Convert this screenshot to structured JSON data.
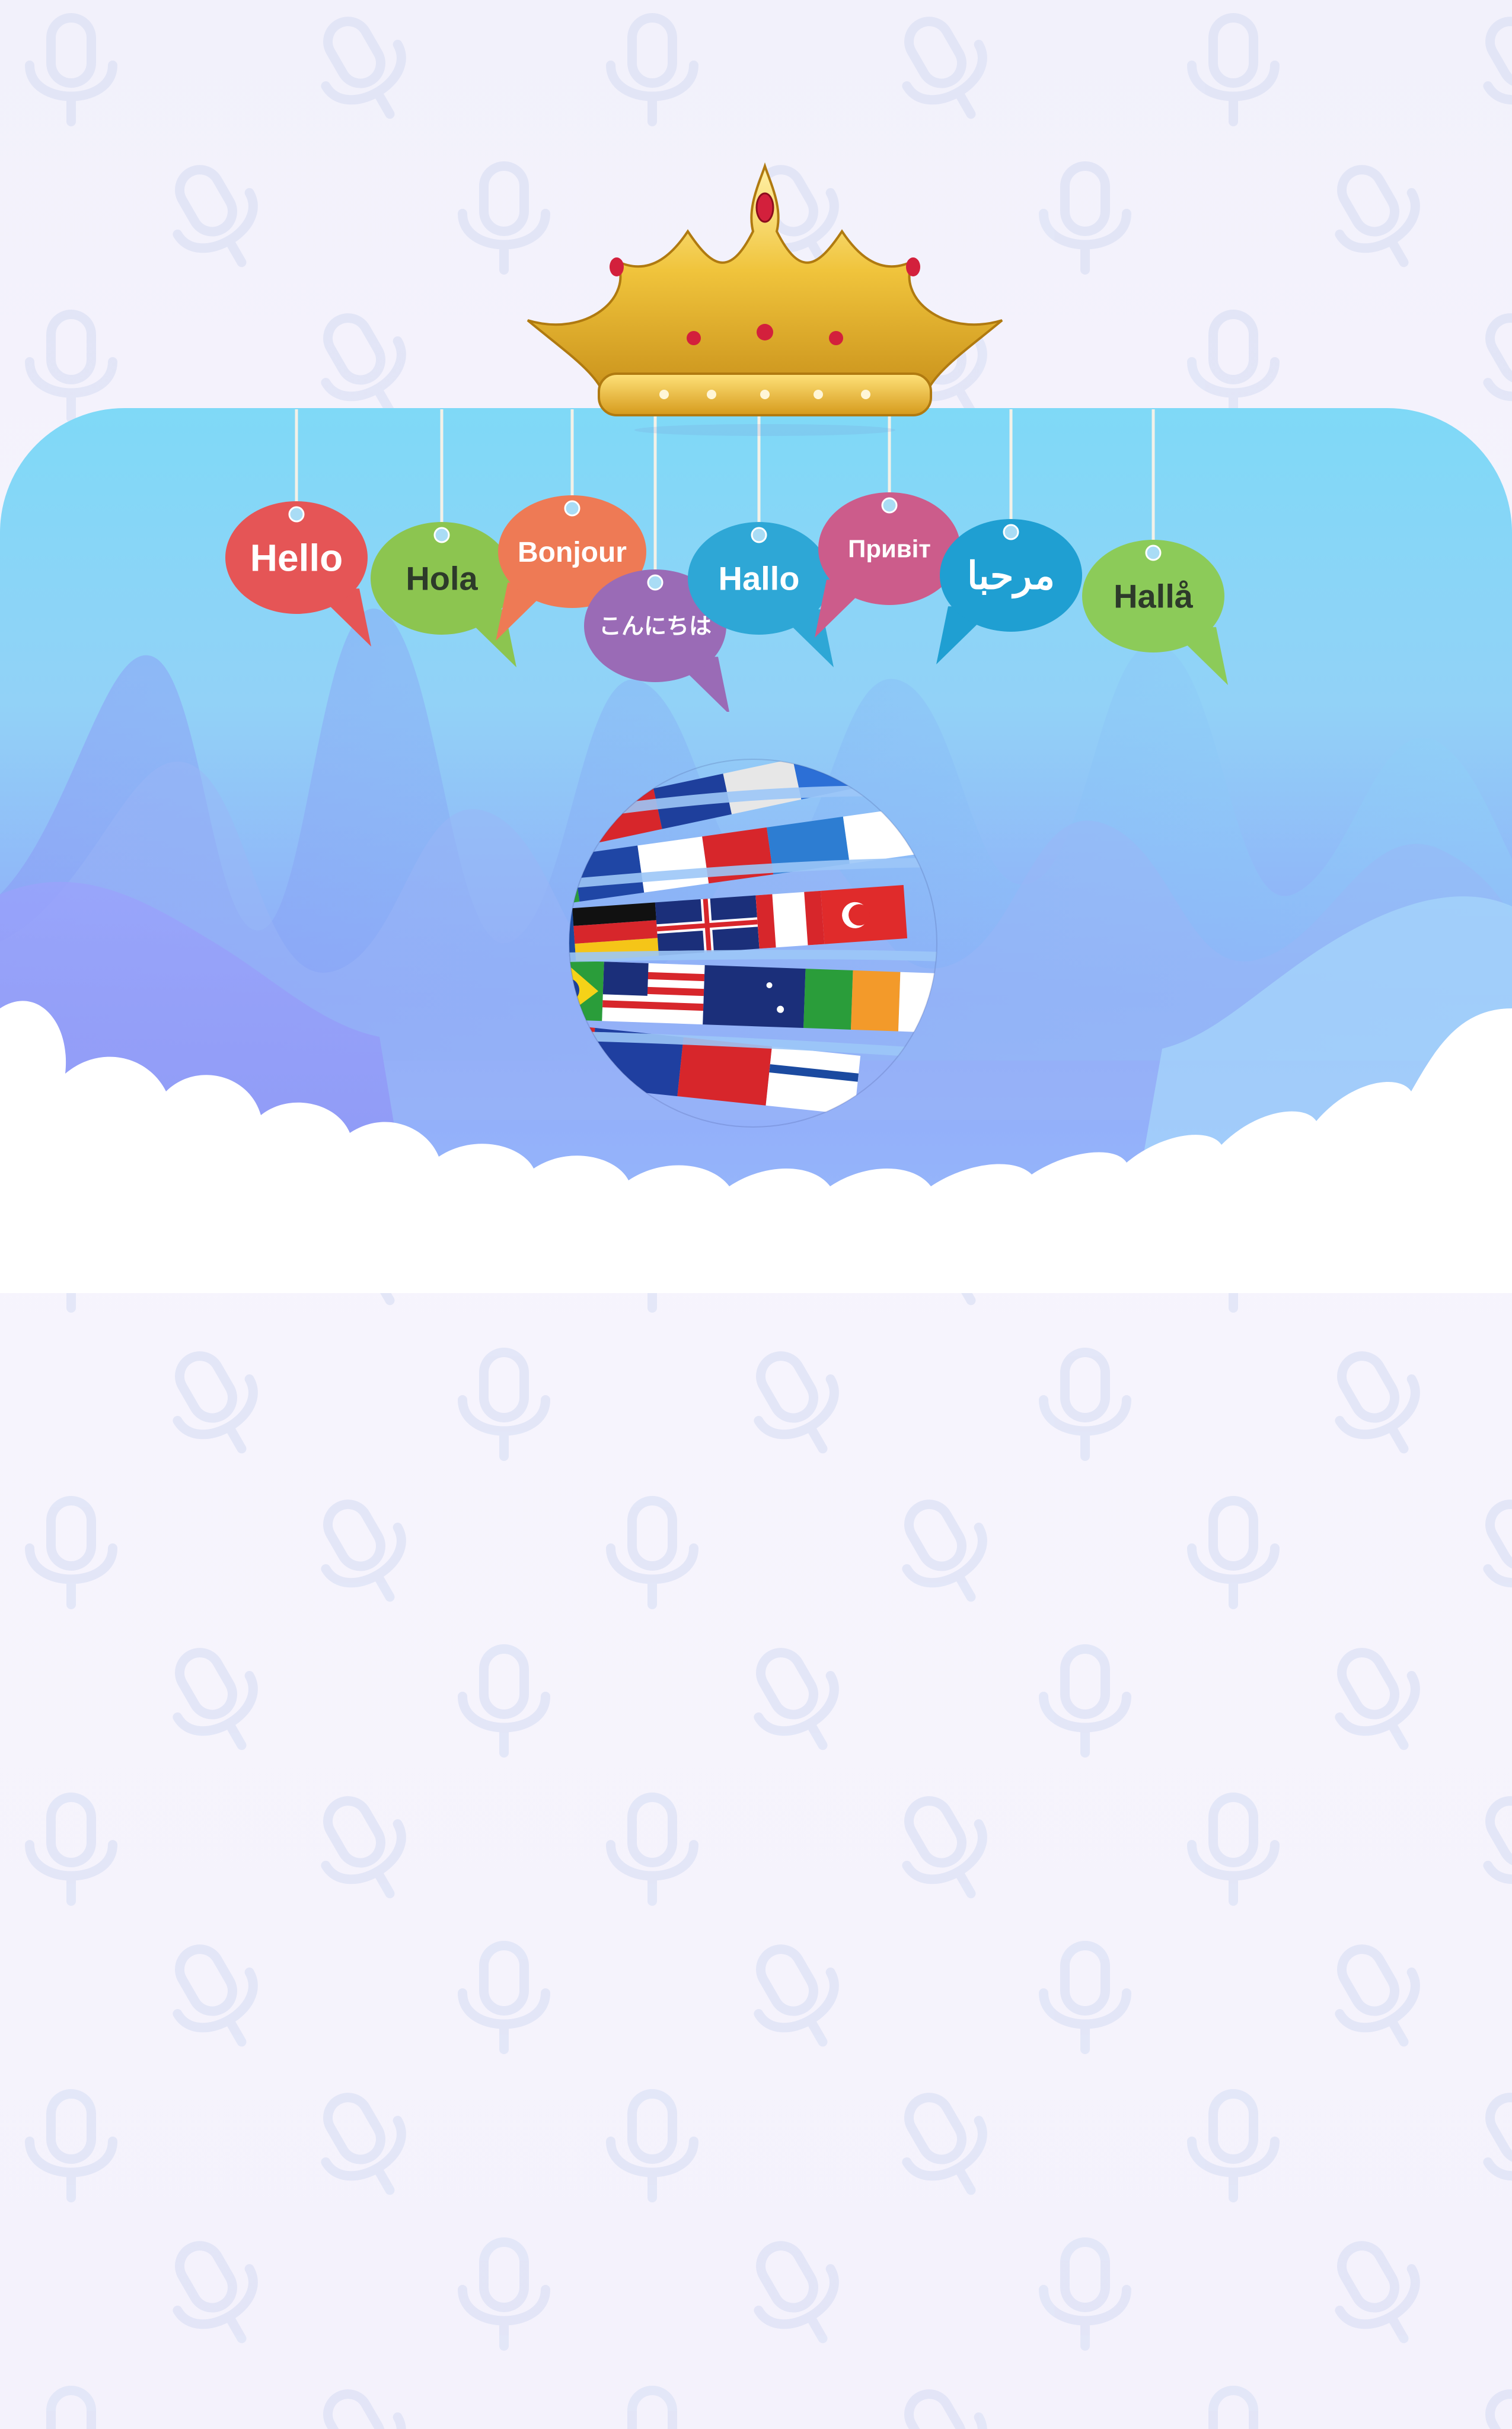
{
  "colors": {
    "page_bg": "#f4f2fc",
    "pattern_icon": "#dfe3f6",
    "hero_top": "#7fd9f7",
    "hero_bottom": "#8fa8f8",
    "cloud": "#ffffff",
    "crown_gold": "#e8b92d",
    "jewel_red": "#d3203c"
  },
  "greetings": [
    {
      "text": "Hello",
      "color": "#e55556"
    },
    {
      "text": "Hola",
      "color": "#8cc550"
    },
    {
      "text": "Bonjour",
      "color": "#ee7a55"
    },
    {
      "text": "こんにちは",
      "color": "#9a6bb6"
    },
    {
      "text": "Hallo",
      "color": "#2ea7d6"
    },
    {
      "text": "Привіт",
      "color": "#cc5c8b"
    },
    {
      "text": "مرحبا",
      "color": "#1f9fd2"
    },
    {
      "text": "Hallå",
      "color": "#8ccb59"
    }
  ],
  "icons": {
    "crown": "crown-icon",
    "globe": "flag-globe-icon",
    "pattern": "microphone-icon"
  }
}
